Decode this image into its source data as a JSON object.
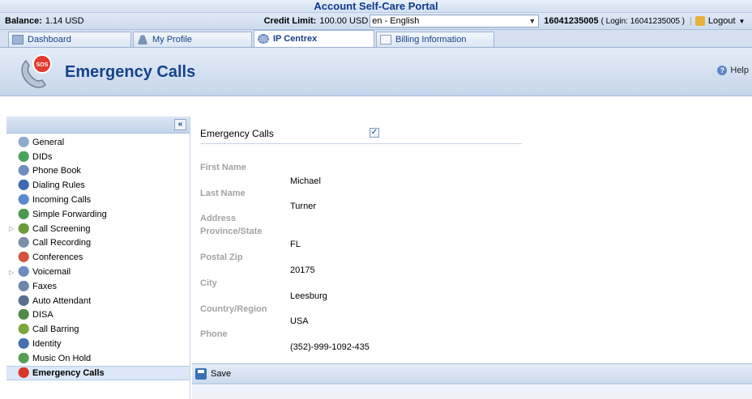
{
  "portal": {
    "title": "Account Self-Care Portal"
  },
  "info": {
    "balance_label": "Balance:",
    "balance_value": "1.14 USD",
    "credit_label": "Credit Limit:",
    "credit_value": "100.00 USD",
    "language": "en - English",
    "account": "16041235005",
    "login": "( Login: 16041235005 )",
    "logout": "Logout"
  },
  "tabs": [
    {
      "label": "Dashboard"
    },
    {
      "label": "My Profile"
    },
    {
      "label": "IP Centrex",
      "active": true
    },
    {
      "label": "Billing Information"
    }
  ],
  "header": {
    "title": "Emergency Calls",
    "help": "Help"
  },
  "sidebar": {
    "items": [
      {
        "label": "General",
        "icon": "gear-icon"
      },
      {
        "label": "DIDs",
        "icon": "did-icon"
      },
      {
        "label": "Phone Book",
        "icon": "phonebook-icon"
      },
      {
        "label": "Dialing Rules",
        "icon": "dialing-rules-icon"
      },
      {
        "label": "Incoming Calls",
        "icon": "incoming-calls-icon"
      },
      {
        "label": "Simple Forwarding",
        "icon": "forwarding-icon"
      },
      {
        "label": "Call Screening",
        "icon": "call-screening-icon",
        "expandable": true
      },
      {
        "label": "Call Recording",
        "icon": "recording-icon"
      },
      {
        "label": "Conferences",
        "icon": "conferences-icon"
      },
      {
        "label": "Voicemail",
        "icon": "voicemail-icon",
        "expandable": true
      },
      {
        "label": "Faxes",
        "icon": "fax-icon"
      },
      {
        "label": "Auto Attendant",
        "icon": "auto-attendant-icon"
      },
      {
        "label": "DISA",
        "icon": "disa-icon"
      },
      {
        "label": "Call Barring",
        "icon": "call-barring-icon"
      },
      {
        "label": "Identity",
        "icon": "identity-icon"
      },
      {
        "label": "Music On Hold",
        "icon": "music-icon"
      },
      {
        "label": "Emergency Calls",
        "icon": "sos-icon",
        "active": true
      }
    ]
  },
  "form": {
    "emergency_label": "Emergency Calls",
    "emergency_checked": true,
    "fields": [
      {
        "label": "First Name",
        "value": "Michael"
      },
      {
        "label": "Last Name",
        "value": "Turner"
      },
      {
        "label": "Address",
        "value": ""
      },
      {
        "label": "Province/State",
        "value": "FL"
      },
      {
        "label": "Postal Zip",
        "value": "20175"
      },
      {
        "label": "City",
        "value": "Leesburg"
      },
      {
        "label": "Country/Region",
        "value": "USA"
      },
      {
        "label": "Phone",
        "value": "(352)-999-1092-435"
      }
    ],
    "save_label": "Save"
  },
  "colors": {
    "accent": "#15428b",
    "title": "#0e3a8c",
    "label_gray": "#a3a3a3"
  }
}
